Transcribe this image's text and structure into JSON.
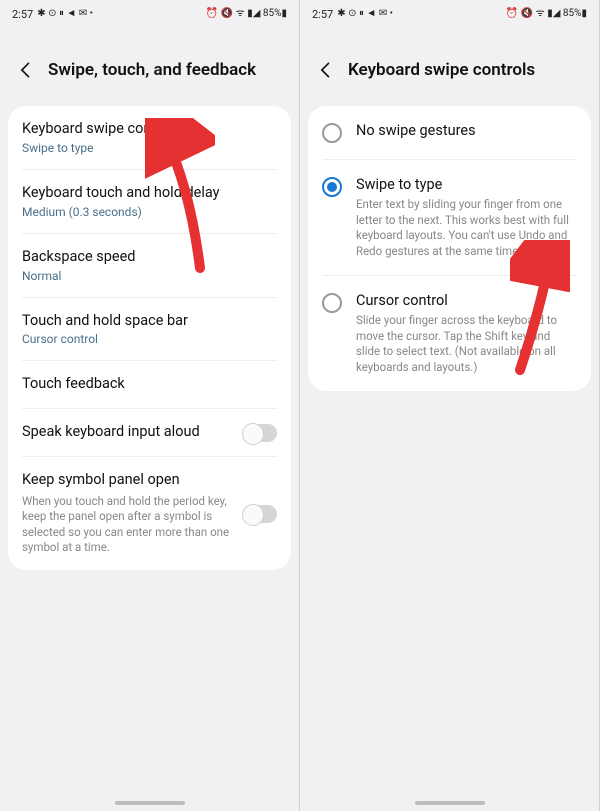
{
  "status": {
    "time": "2:57",
    "icons_left": "✱ ⊙ ⏸ ◄ ✉ •",
    "icons_right": "⏰ 🔇 ᯤ ▮◢ 85%▮"
  },
  "left": {
    "title": "Swipe, touch, and feedback",
    "items": {
      "kbswipe": {
        "title": "Keyboard swipe controls",
        "sub": "Swipe to type"
      },
      "holddelay": {
        "title": "Keyboard touch and hold delay",
        "sub": "Medium (0.3 seconds)"
      },
      "backspace": {
        "title": "Backspace speed",
        "sub": "Normal"
      },
      "spacebar": {
        "title": "Touch and hold space bar",
        "sub": "Cursor control"
      },
      "touchfb": {
        "title": "Touch feedback"
      },
      "speak": {
        "title": "Speak keyboard input aloud"
      },
      "symbol": {
        "title": "Keep symbol panel open",
        "desc": "When you touch and hold the period key, keep the panel open after a symbol is selected so you can enter more than one symbol at a time."
      }
    }
  },
  "right": {
    "title": "Keyboard swipe controls",
    "options": {
      "none": {
        "title": "No swipe gestures"
      },
      "swipe": {
        "title": "Swipe to type",
        "desc": "Enter text by sliding your finger from one letter to the next. This works best with full keyboard layouts. You can't use Undo and Redo gestures at the same time."
      },
      "cursor": {
        "title": "Cursor control",
        "desc": "Slide your finger across the keyboard to move the cursor. Tap the Shift key and slide to select text. (Not available on all keyboards and layouts.)"
      }
    }
  }
}
